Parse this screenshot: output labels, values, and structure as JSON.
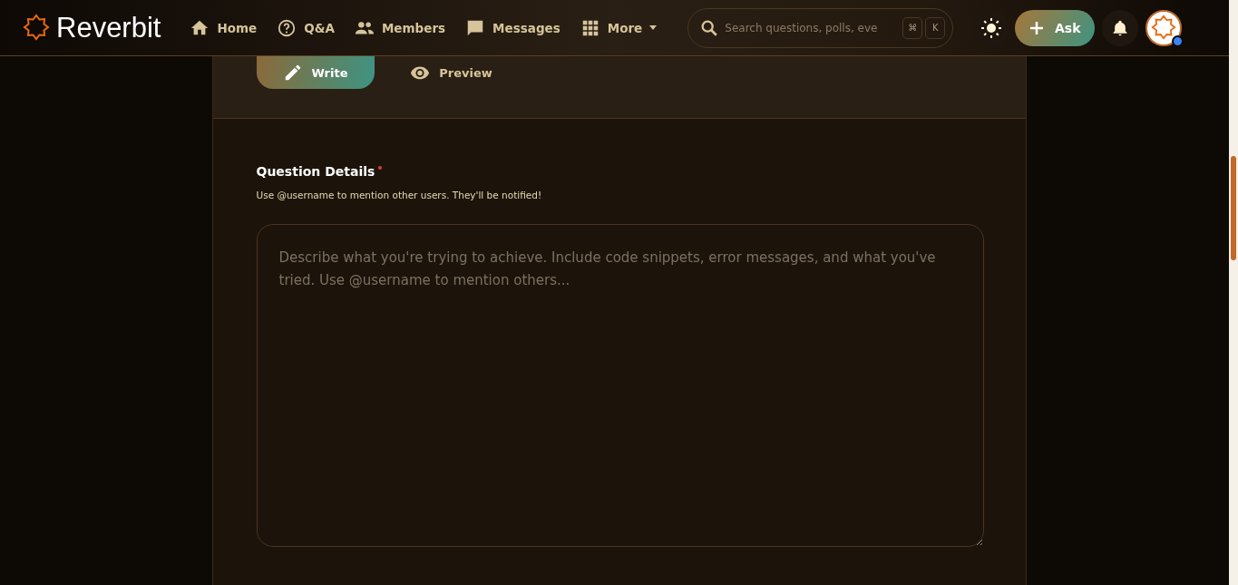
{
  "header": {
    "logo": "Reverbit",
    "nav": [
      {
        "label": "Home",
        "dropdown": false
      },
      {
        "label": "Q&A",
        "dropdown": false
      },
      {
        "label": "Members",
        "dropdown": false
      },
      {
        "label": "Messages",
        "dropdown": false
      },
      {
        "label": "More",
        "dropdown": true
      }
    ],
    "search": {
      "placeholder": "Search questions, polls, eve",
      "keys": [
        "⌘",
        "K"
      ]
    },
    "ask_button": "Ask"
  },
  "editor": {
    "tabs": [
      {
        "label": "Write",
        "selected": true
      },
      {
        "label": "Preview",
        "selected": false
      }
    ],
    "field": {
      "label": "Question Details",
      "required": true,
      "hint": "Use @username to mention other users. They'll be notified!",
      "placeholder": "Describe what you're trying to achieve. Include code snippets, error messages, and what you've tried. Use @username to mention others..."
    }
  }
}
